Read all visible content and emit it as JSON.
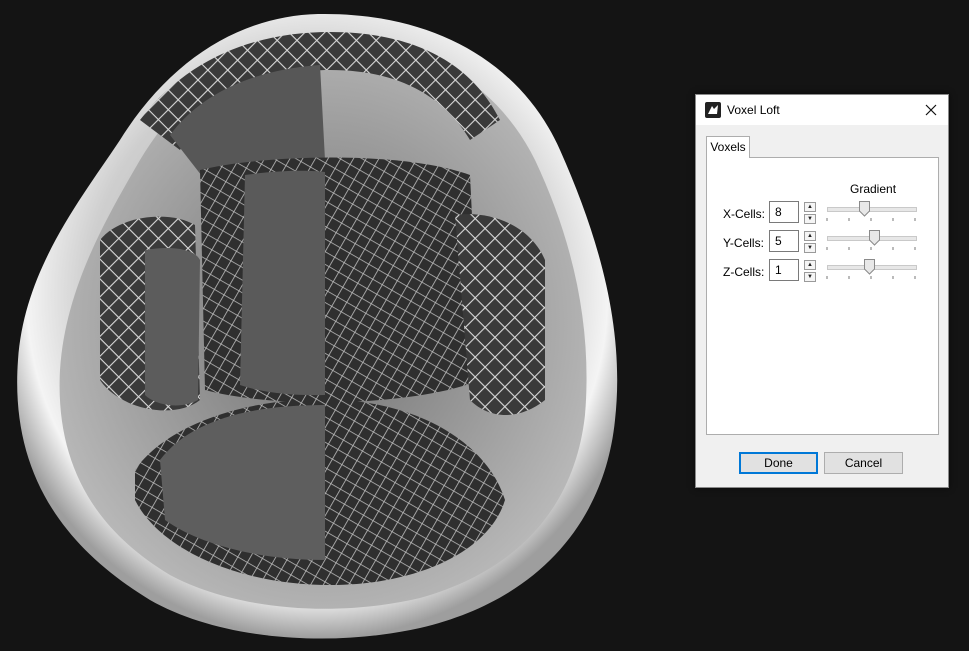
{
  "viewport": {
    "description_icon": "helmet-liner-lattice-render"
  },
  "dialog": {
    "title": "Voxel Loft",
    "icon": "rhino-app-icon",
    "close_icon": "close-icon",
    "tabs": [
      {
        "label": "Voxels"
      }
    ],
    "gradient_label": "Gradient",
    "rows": [
      {
        "label": "X-Cells:",
        "value": "8",
        "gradient": 0.43
      },
      {
        "label": "Y-Cells:",
        "value": "5",
        "gradient": 0.54
      },
      {
        "label": "Z-Cells:",
        "value": "1",
        "gradient": 0.48
      }
    ],
    "done_label": "Done",
    "cancel_label": "Cancel"
  },
  "colors": {
    "background": "#141414",
    "dialog": "#f0f0f0",
    "accent": "#0078d7"
  }
}
